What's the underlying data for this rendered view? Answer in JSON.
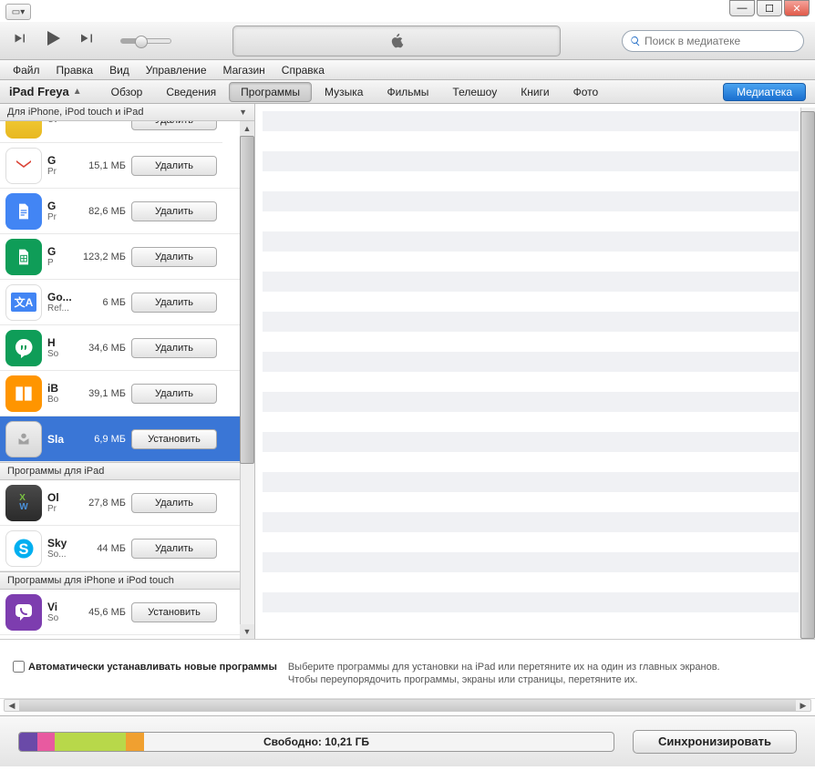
{
  "search": {
    "placeholder": "Поиск в медиатеке"
  },
  "menu": {
    "file": "Файл",
    "edit": "Правка",
    "view": "Вид",
    "controls": "Управление",
    "store": "Магазин",
    "help": "Справка"
  },
  "device": {
    "name": "iPad Freya"
  },
  "tabs": {
    "overview": "Обзор",
    "info": "Сведения",
    "apps": "Программы",
    "music": "Музыка",
    "movies": "Фильмы",
    "tv": "Телешоу",
    "books": "Книги",
    "photos": "Фото"
  },
  "library_btn": "Медиатека",
  "headers": {
    "universal": "Для iPhone, iPod touch и iPad",
    "ipad": "Программы для iPad",
    "iphone": "Программы для iPhone и iPod touch"
  },
  "buttons": {
    "delete": "Удалить",
    "install": "Установить"
  },
  "apps_universal": [
    {
      "name": "",
      "sub": "Ut",
      "size": "",
      "action": "delete",
      "icon": "ic-yellow"
    },
    {
      "name": "G",
      "sub": "Pr",
      "size": "15,1 МБ",
      "action": "delete",
      "icon": "ic-gmail"
    },
    {
      "name": "G",
      "sub": "Pr",
      "size": "82,6 МБ",
      "action": "delete",
      "icon": "ic-docs"
    },
    {
      "name": "G",
      "sub": "P",
      "size": "123,2 МБ",
      "action": "delete",
      "icon": "ic-sheets"
    },
    {
      "name": "Go...",
      "sub": "Ref...",
      "size": "6 МБ",
      "action": "delete",
      "icon": "ic-translate"
    },
    {
      "name": "H",
      "sub": "So",
      "size": "34,6 МБ",
      "action": "delete",
      "icon": "ic-hangouts"
    },
    {
      "name": "iB",
      "sub": "Bo",
      "size": "39,1 МБ",
      "action": "delete",
      "icon": "ic-ibooks"
    },
    {
      "name": "Sla",
      "sub": "",
      "size": "6,9 МБ",
      "action": "install",
      "icon": "ic-generic",
      "selected": true
    }
  ],
  "apps_ipad": [
    {
      "name": "Ol",
      "sub": "Pr",
      "size": "27,8 МБ",
      "action": "delete",
      "icon": "ic-office"
    },
    {
      "name": "Sky",
      "sub": "So...",
      "size": "44 МБ",
      "action": "delete",
      "icon": "ic-skype"
    }
  ],
  "apps_iphone": [
    {
      "name": "Vi",
      "sub": "So",
      "size": "45,6 МБ",
      "action": "install",
      "icon": "ic-viber"
    }
  ],
  "footer": {
    "auto_install": "Автоматически устанавливать новые программы",
    "hint1": "Выберите программы для установки на iPad или перетяните их на один из главных экранов.",
    "hint2": "Чтобы переупорядочить программы, экраны или страницы, перетяните их."
  },
  "capacity": {
    "segments": [
      {
        "color": "#6a4aa8",
        "pct": 3
      },
      {
        "color": "#e85aa0",
        "pct": 3
      },
      {
        "color": "#b8d84a",
        "pct": 12
      },
      {
        "color": "#f0a030",
        "pct": 3
      }
    ],
    "free_prefix": "Свободно: ",
    "free_value": "10,21 ГБ"
  },
  "sync_btn": "Синхронизировать"
}
